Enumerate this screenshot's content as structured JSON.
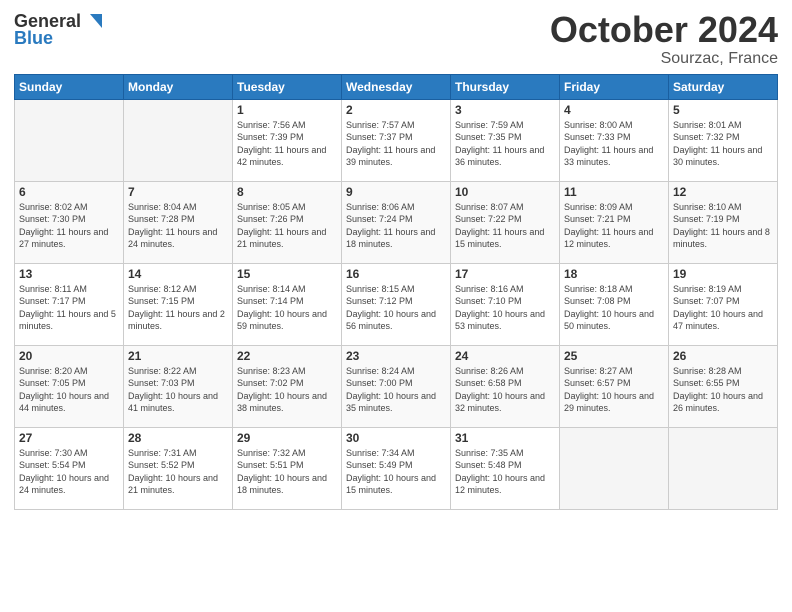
{
  "header": {
    "logo_general": "General",
    "logo_blue": "Blue",
    "month_title": "October 2024",
    "location": "Sourzac, France"
  },
  "weekdays": [
    "Sunday",
    "Monday",
    "Tuesday",
    "Wednesday",
    "Thursday",
    "Friday",
    "Saturday"
  ],
  "weeks": [
    [
      {
        "day": "",
        "info": ""
      },
      {
        "day": "",
        "info": ""
      },
      {
        "day": "1",
        "info": "Sunrise: 7:56 AM\nSunset: 7:39 PM\nDaylight: 11 hours and 42 minutes."
      },
      {
        "day": "2",
        "info": "Sunrise: 7:57 AM\nSunset: 7:37 PM\nDaylight: 11 hours and 39 minutes."
      },
      {
        "day": "3",
        "info": "Sunrise: 7:59 AM\nSunset: 7:35 PM\nDaylight: 11 hours and 36 minutes."
      },
      {
        "day": "4",
        "info": "Sunrise: 8:00 AM\nSunset: 7:33 PM\nDaylight: 11 hours and 33 minutes."
      },
      {
        "day": "5",
        "info": "Sunrise: 8:01 AM\nSunset: 7:32 PM\nDaylight: 11 hours and 30 minutes."
      }
    ],
    [
      {
        "day": "6",
        "info": "Sunrise: 8:02 AM\nSunset: 7:30 PM\nDaylight: 11 hours and 27 minutes."
      },
      {
        "day": "7",
        "info": "Sunrise: 8:04 AM\nSunset: 7:28 PM\nDaylight: 11 hours and 24 minutes."
      },
      {
        "day": "8",
        "info": "Sunrise: 8:05 AM\nSunset: 7:26 PM\nDaylight: 11 hours and 21 minutes."
      },
      {
        "day": "9",
        "info": "Sunrise: 8:06 AM\nSunset: 7:24 PM\nDaylight: 11 hours and 18 minutes."
      },
      {
        "day": "10",
        "info": "Sunrise: 8:07 AM\nSunset: 7:22 PM\nDaylight: 11 hours and 15 minutes."
      },
      {
        "day": "11",
        "info": "Sunrise: 8:09 AM\nSunset: 7:21 PM\nDaylight: 11 hours and 12 minutes."
      },
      {
        "day": "12",
        "info": "Sunrise: 8:10 AM\nSunset: 7:19 PM\nDaylight: 11 hours and 8 minutes."
      }
    ],
    [
      {
        "day": "13",
        "info": "Sunrise: 8:11 AM\nSunset: 7:17 PM\nDaylight: 11 hours and 5 minutes."
      },
      {
        "day": "14",
        "info": "Sunrise: 8:12 AM\nSunset: 7:15 PM\nDaylight: 11 hours and 2 minutes."
      },
      {
        "day": "15",
        "info": "Sunrise: 8:14 AM\nSunset: 7:14 PM\nDaylight: 10 hours and 59 minutes."
      },
      {
        "day": "16",
        "info": "Sunrise: 8:15 AM\nSunset: 7:12 PM\nDaylight: 10 hours and 56 minutes."
      },
      {
        "day": "17",
        "info": "Sunrise: 8:16 AM\nSunset: 7:10 PM\nDaylight: 10 hours and 53 minutes."
      },
      {
        "day": "18",
        "info": "Sunrise: 8:18 AM\nSunset: 7:08 PM\nDaylight: 10 hours and 50 minutes."
      },
      {
        "day": "19",
        "info": "Sunrise: 8:19 AM\nSunset: 7:07 PM\nDaylight: 10 hours and 47 minutes."
      }
    ],
    [
      {
        "day": "20",
        "info": "Sunrise: 8:20 AM\nSunset: 7:05 PM\nDaylight: 10 hours and 44 minutes."
      },
      {
        "day": "21",
        "info": "Sunrise: 8:22 AM\nSunset: 7:03 PM\nDaylight: 10 hours and 41 minutes."
      },
      {
        "day": "22",
        "info": "Sunrise: 8:23 AM\nSunset: 7:02 PM\nDaylight: 10 hours and 38 minutes."
      },
      {
        "day": "23",
        "info": "Sunrise: 8:24 AM\nSunset: 7:00 PM\nDaylight: 10 hours and 35 minutes."
      },
      {
        "day": "24",
        "info": "Sunrise: 8:26 AM\nSunset: 6:58 PM\nDaylight: 10 hours and 32 minutes."
      },
      {
        "day": "25",
        "info": "Sunrise: 8:27 AM\nSunset: 6:57 PM\nDaylight: 10 hours and 29 minutes."
      },
      {
        "day": "26",
        "info": "Sunrise: 8:28 AM\nSunset: 6:55 PM\nDaylight: 10 hours and 26 minutes."
      }
    ],
    [
      {
        "day": "27",
        "info": "Sunrise: 7:30 AM\nSunset: 5:54 PM\nDaylight: 10 hours and 24 minutes."
      },
      {
        "day": "28",
        "info": "Sunrise: 7:31 AM\nSunset: 5:52 PM\nDaylight: 10 hours and 21 minutes."
      },
      {
        "day": "29",
        "info": "Sunrise: 7:32 AM\nSunset: 5:51 PM\nDaylight: 10 hours and 18 minutes."
      },
      {
        "day": "30",
        "info": "Sunrise: 7:34 AM\nSunset: 5:49 PM\nDaylight: 10 hours and 15 minutes."
      },
      {
        "day": "31",
        "info": "Sunrise: 7:35 AM\nSunset: 5:48 PM\nDaylight: 10 hours and 12 minutes."
      },
      {
        "day": "",
        "info": ""
      },
      {
        "day": "",
        "info": ""
      }
    ]
  ]
}
